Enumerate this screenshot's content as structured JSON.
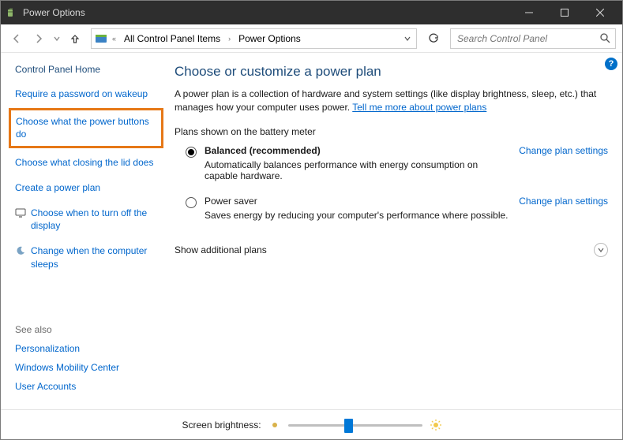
{
  "titlebar": {
    "title": "Power Options"
  },
  "breadcrumb": {
    "items": [
      "All Control Panel Items",
      "Power Options"
    ]
  },
  "search": {
    "placeholder": "Search Control Panel"
  },
  "sidebar": {
    "home": "Control Panel Home",
    "links": [
      "Require a password on wakeup",
      "Choose what the power buttons do",
      "Choose what closing the lid does",
      "Create a power plan",
      "Choose when to turn off the display",
      "Change when the computer sleeps"
    ],
    "highlighted_index": 1,
    "see_also_heading": "See also",
    "see_also": [
      "Personalization",
      "Windows Mobility Center",
      "User Accounts"
    ]
  },
  "main": {
    "heading": "Choose or customize a power plan",
    "intro": "A power plan is a collection of hardware and system settings (like display brightness, sleep, etc.) that manages how your computer uses power. ",
    "intro_link": "Tell me more about power plans",
    "section_label": "Plans shown on the battery meter",
    "plans": [
      {
        "name": "Balanced (recommended)",
        "selected": true,
        "desc": "Automatically balances performance with energy consumption on capable hardware.",
        "change_label": "Change plan settings"
      },
      {
        "name": "Power saver",
        "selected": false,
        "desc": "Saves energy by reducing your computer's performance where possible.",
        "change_label": "Change plan settings"
      }
    ],
    "additional_label": "Show additional plans"
  },
  "footer": {
    "label": "Screen brightness:",
    "brightness_percent": 45
  }
}
